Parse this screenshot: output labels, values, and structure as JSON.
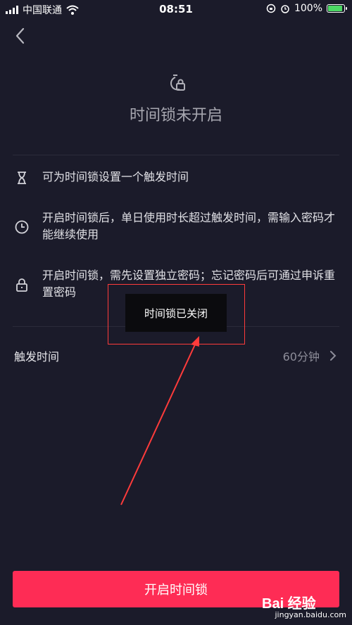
{
  "status_bar": {
    "carrier": "中国联通",
    "time": "08:51",
    "battery_percent": "100%",
    "battery_level": 1.0,
    "icons": [
      "signal-icon",
      "wifi-icon",
      "rotation-lock-icon",
      "alarm-icon",
      "battery-icon"
    ]
  },
  "header": {
    "back_icon": "chevron-left-icon",
    "title_icon": "lock-clock-icon",
    "title": "时间锁未开启"
  },
  "info": [
    {
      "icon": "hourglass-icon",
      "text": "可为时间锁设置一个触发时间"
    },
    {
      "icon": "clock-icon",
      "text": "开启时间锁后，单日使用时长超过触发时间，需输入密码才能继续使用"
    },
    {
      "icon": "padlock-icon",
      "text": "开启时间锁，需先设置独立密码；忘记密码后可通过申诉重置密码"
    }
  ],
  "setting": {
    "label": "触发时间",
    "value": "60分钟",
    "chevron_icon": "chevron-right-icon"
  },
  "toast": {
    "text": "时间锁已关闭"
  },
  "primary_button": {
    "label": "开启时间锁",
    "color": "#fe2c55"
  },
  "watermark": {
    "brand": "Bai 经验",
    "domain": "jingyan.baidu.com"
  },
  "annotation": {
    "box_color": "#ff3b3b"
  }
}
